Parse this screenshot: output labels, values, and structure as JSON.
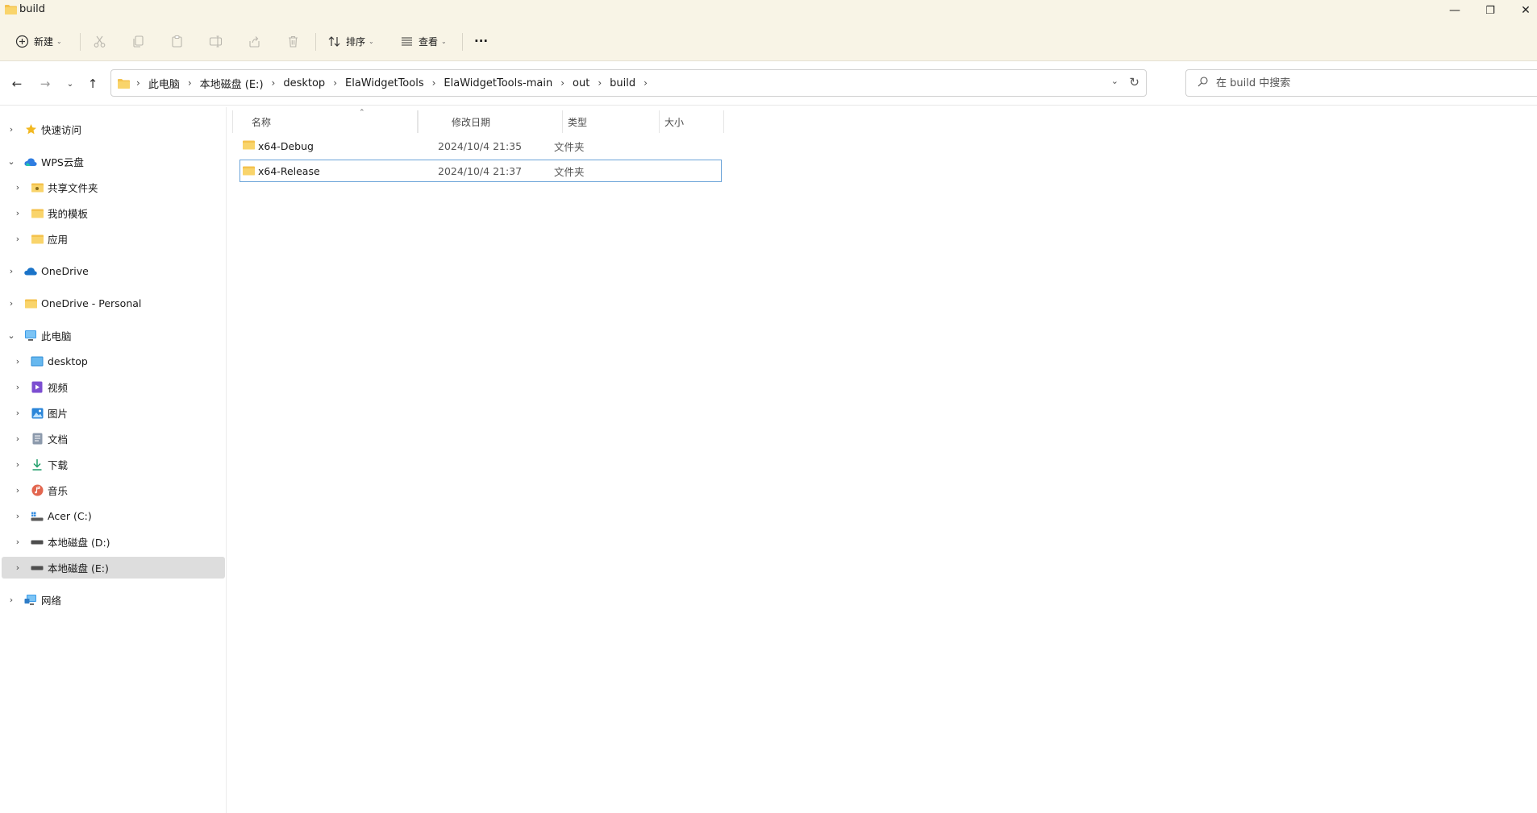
{
  "window": {
    "title": "build",
    "controls": {
      "minimize": "—",
      "restore": "❐",
      "close": "✕"
    }
  },
  "toolbar": {
    "new_label": "新建",
    "sort_label": "排序",
    "view_label": "查看",
    "more_label": "···"
  },
  "address": {
    "crumbs": [
      "此电脑",
      "本地磁盘 (E:)",
      "desktop",
      "ElaWidgetTools",
      "ElaWidgetTools-main",
      "out",
      "build"
    ]
  },
  "search": {
    "placeholder": "在 build 中搜索"
  },
  "sidebar": {
    "items": [
      {
        "label": "快速访问",
        "icon": "star-icon"
      },
      {
        "label": "WPS云盘",
        "icon": "cloud-icon"
      },
      {
        "label": "共享文件夹",
        "icon": "shared-folder-icon"
      },
      {
        "label": "我的模板",
        "icon": "folder-icon"
      },
      {
        "label": "应用",
        "icon": "folder-icon"
      },
      {
        "label": "OneDrive",
        "icon": "onedrive-icon"
      },
      {
        "label": "OneDrive - Personal",
        "icon": "folder-icon"
      },
      {
        "label": "此电脑",
        "icon": "computer-icon"
      },
      {
        "label": "desktop",
        "icon": "desktop-icon"
      },
      {
        "label": "视频",
        "icon": "video-icon"
      },
      {
        "label": "图片",
        "icon": "pictures-icon"
      },
      {
        "label": "文档",
        "icon": "documents-icon"
      },
      {
        "label": "下载",
        "icon": "download-icon"
      },
      {
        "label": "音乐",
        "icon": "music-icon"
      },
      {
        "label": "Acer (C:)",
        "icon": "system-drive-icon"
      },
      {
        "label": "本地磁盘 (D:)",
        "icon": "drive-icon"
      },
      {
        "label": "本地磁盘 (E:)",
        "icon": "drive-icon"
      },
      {
        "label": "网络",
        "icon": "network-icon"
      }
    ]
  },
  "columns": {
    "name": "名称",
    "modified": "修改日期",
    "type": "类型",
    "size": "大小"
  },
  "files": [
    {
      "name": "x64-Debug",
      "modified": "2024/10/4 21:35",
      "type": "文件夹"
    },
    {
      "name": "x64-Release",
      "modified": "2024/10/4 21:37",
      "type": "文件夹"
    }
  ],
  "colors": {
    "toolbar_bg": "#f8f4e6",
    "folder": "#f4c24d",
    "selection_border": "#6aa3d8",
    "accent": "#1a73c8"
  }
}
